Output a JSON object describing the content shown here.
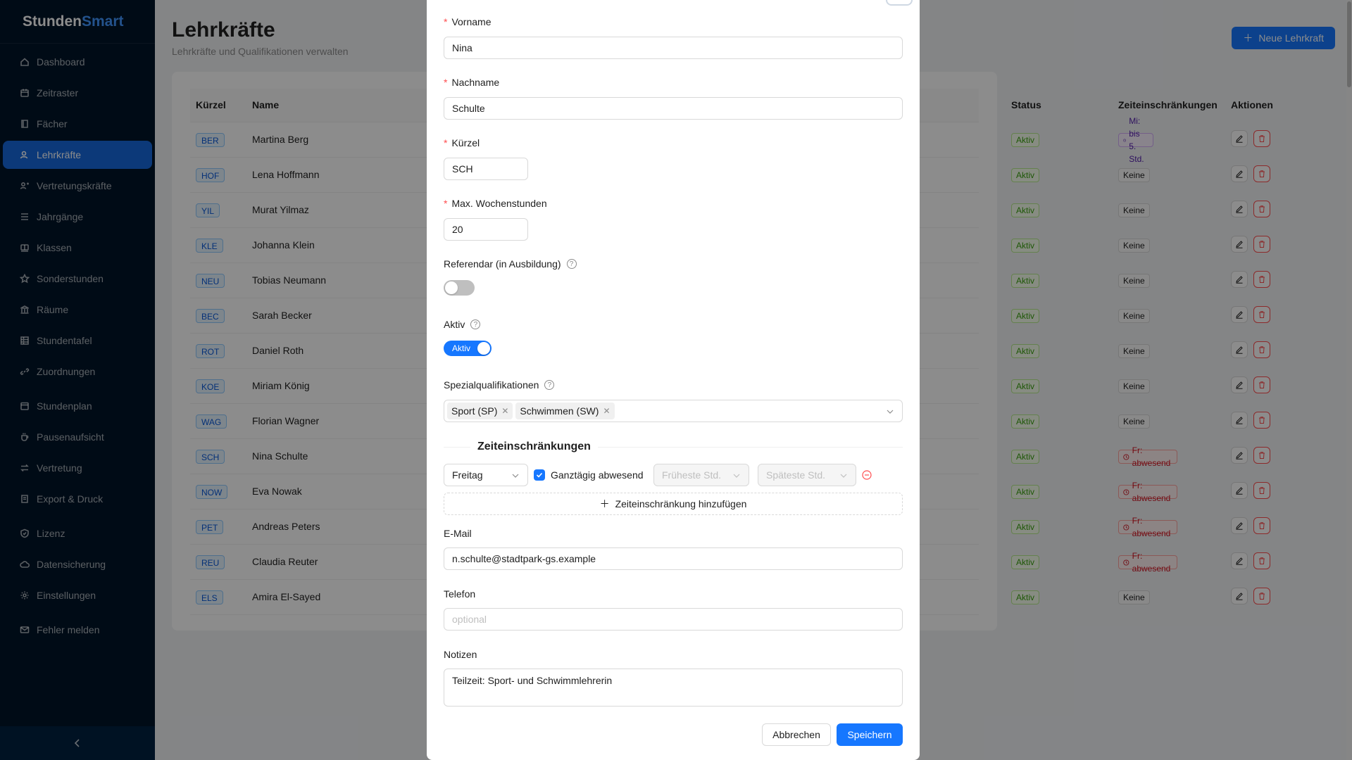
{
  "app": {
    "logo_part1": "Stunden",
    "logo_part2": "Smart"
  },
  "sidebar": {
    "items": [
      {
        "label": "Dashboard",
        "icon": "home-icon"
      },
      {
        "label": "Zeitraster",
        "icon": "calendar-icon"
      },
      {
        "label": "Fächer",
        "icon": "book-icon"
      },
      {
        "label": "Lehrkräfte",
        "icon": "users-icon",
        "active": true
      },
      {
        "label": "Vertretungskräfte",
        "icon": "user-switch-icon"
      },
      {
        "label": "Jahrgänge",
        "icon": "list-icon"
      },
      {
        "label": "Klassen",
        "icon": "classroom-icon"
      },
      {
        "label": "Sonderstunden",
        "icon": "star-icon"
      },
      {
        "label": "Räume",
        "icon": "bank-icon"
      },
      {
        "label": "Stundentafel",
        "icon": "table-icon"
      },
      {
        "label": "Zuordnungen",
        "icon": "link-icon"
      },
      {
        "label": "Stundenplan",
        "icon": "schedule-icon"
      },
      {
        "label": "Pausenaufsicht",
        "icon": "coffee-icon"
      },
      {
        "label": "Vertretung",
        "icon": "swap-icon"
      },
      {
        "label": "Export & Druck",
        "icon": "export-icon"
      },
      {
        "label": "Lizenz",
        "icon": "safety-icon"
      },
      {
        "label": "Datensicherung",
        "icon": "cloud-icon"
      },
      {
        "label": "Einstellungen",
        "icon": "gear-icon"
      },
      {
        "label": "Fehler melden",
        "icon": "mail-icon"
      }
    ]
  },
  "header": {
    "title": "Lehrkräfte",
    "subtitle": "Lehrkräfte und Qualifikationen verwalten",
    "new_button": "Neue Lehrkraft"
  },
  "table": {
    "columns": {
      "kuerzel": "Kürzel",
      "name": "Name",
      "status": "Status",
      "zeit": "Zeiteinschränkungen",
      "aktionen": "Aktionen"
    },
    "rows": [
      {
        "kuerzel": "BER",
        "name": "Martina Berg",
        "status": "Aktiv",
        "zeit": "Mi: bis 5. Std.",
        "zeit_kind": "purple"
      },
      {
        "kuerzel": "HOF",
        "name": "Lena Hoffmann",
        "status": "Aktiv",
        "zeit": "Keine",
        "zeit_kind": "gray"
      },
      {
        "kuerzel": "YIL",
        "name": "Murat Yilmaz",
        "status": "Aktiv",
        "zeit": "Keine",
        "zeit_kind": "gray"
      },
      {
        "kuerzel": "KLE",
        "name": "Johanna Klein",
        "status": "Aktiv",
        "zeit": "Keine",
        "zeit_kind": "gray"
      },
      {
        "kuerzel": "NEU",
        "name": "Tobias Neumann",
        "status": "Aktiv",
        "zeit": "Keine",
        "zeit_kind": "gray"
      },
      {
        "kuerzel": "BEC",
        "name": "Sarah Becker",
        "status": "Aktiv",
        "zeit": "Keine",
        "zeit_kind": "gray"
      },
      {
        "kuerzel": "ROT",
        "name": "Daniel Roth",
        "status": "Aktiv",
        "zeit": "Keine",
        "zeit_kind": "gray"
      },
      {
        "kuerzel": "KOE",
        "name": "Miriam König",
        "status": "Aktiv",
        "zeit": "Keine",
        "zeit_kind": "gray"
      },
      {
        "kuerzel": "WAG",
        "name": "Florian Wagner",
        "status": "Aktiv",
        "zeit": "Keine",
        "zeit_kind": "gray"
      },
      {
        "kuerzel": "SCH",
        "name": "Nina Schulte",
        "status": "Aktiv",
        "zeit": "Fr: abwesend",
        "zeit_kind": "red"
      },
      {
        "kuerzel": "NOW",
        "name": "Eva Nowak",
        "status": "Aktiv",
        "zeit": "Fr: abwesend",
        "zeit_kind": "red"
      },
      {
        "kuerzel": "PET",
        "name": "Andreas Peters",
        "status": "Aktiv",
        "zeit": "Fr: abwesend",
        "zeit_kind": "red"
      },
      {
        "kuerzel": "REU",
        "name": "Claudia Reuter",
        "status": "Aktiv",
        "zeit": "Fr: abwesend",
        "zeit_kind": "red"
      },
      {
        "kuerzel": "ELS",
        "name": "Amira El-Sayed",
        "status": "Aktiv",
        "zeit": "Keine",
        "zeit_kind": "gray"
      }
    ]
  },
  "modal": {
    "vorname_label": "Vorname",
    "vorname_value": "Nina",
    "nachname_label": "Nachname",
    "nachname_value": "Schulte",
    "kuerzel_label": "Kürzel",
    "kuerzel_value": "SCH",
    "wochenstunden_label": "Max. Wochenstunden",
    "wochenstunden_value": "20",
    "referendar_label": "Referendar (in Ausbildung)",
    "referendar_on": false,
    "aktiv_label": "Aktiv",
    "aktiv_switch_text": "Aktiv",
    "aktiv_on": true,
    "spezial_label": "Spezialqualifikationen",
    "spezial_tags": [
      "Sport (SP)",
      "Schwimmen (SW)"
    ],
    "zeit_section_title": "Zeiteinschränkungen",
    "zeit_day": "Freitag",
    "zeit_allday_label": "Ganztägig abwesend",
    "zeit_allday_checked": true,
    "zeit_earliest_placeholder": "Früheste Std.",
    "zeit_latest_placeholder": "Späteste Std.",
    "zeit_add_label": "Zeiteinschränkung hinzufügen",
    "email_label": "E-Mail",
    "email_value": "n.schulte@stadtpark-gs.example",
    "telefon_label": "Telefon",
    "telefon_placeholder": "optional",
    "notizen_label": "Notizen",
    "notizen_value": "Teilzeit: Sport- und Schwimmlehrerin",
    "cancel_label": "Abbrechen",
    "save_label": "Speichern"
  },
  "colors": {
    "primary": "#1677ff",
    "sidebar_bg": "#001529",
    "danger": "#ff4d4f",
    "success": "#389e0d"
  }
}
